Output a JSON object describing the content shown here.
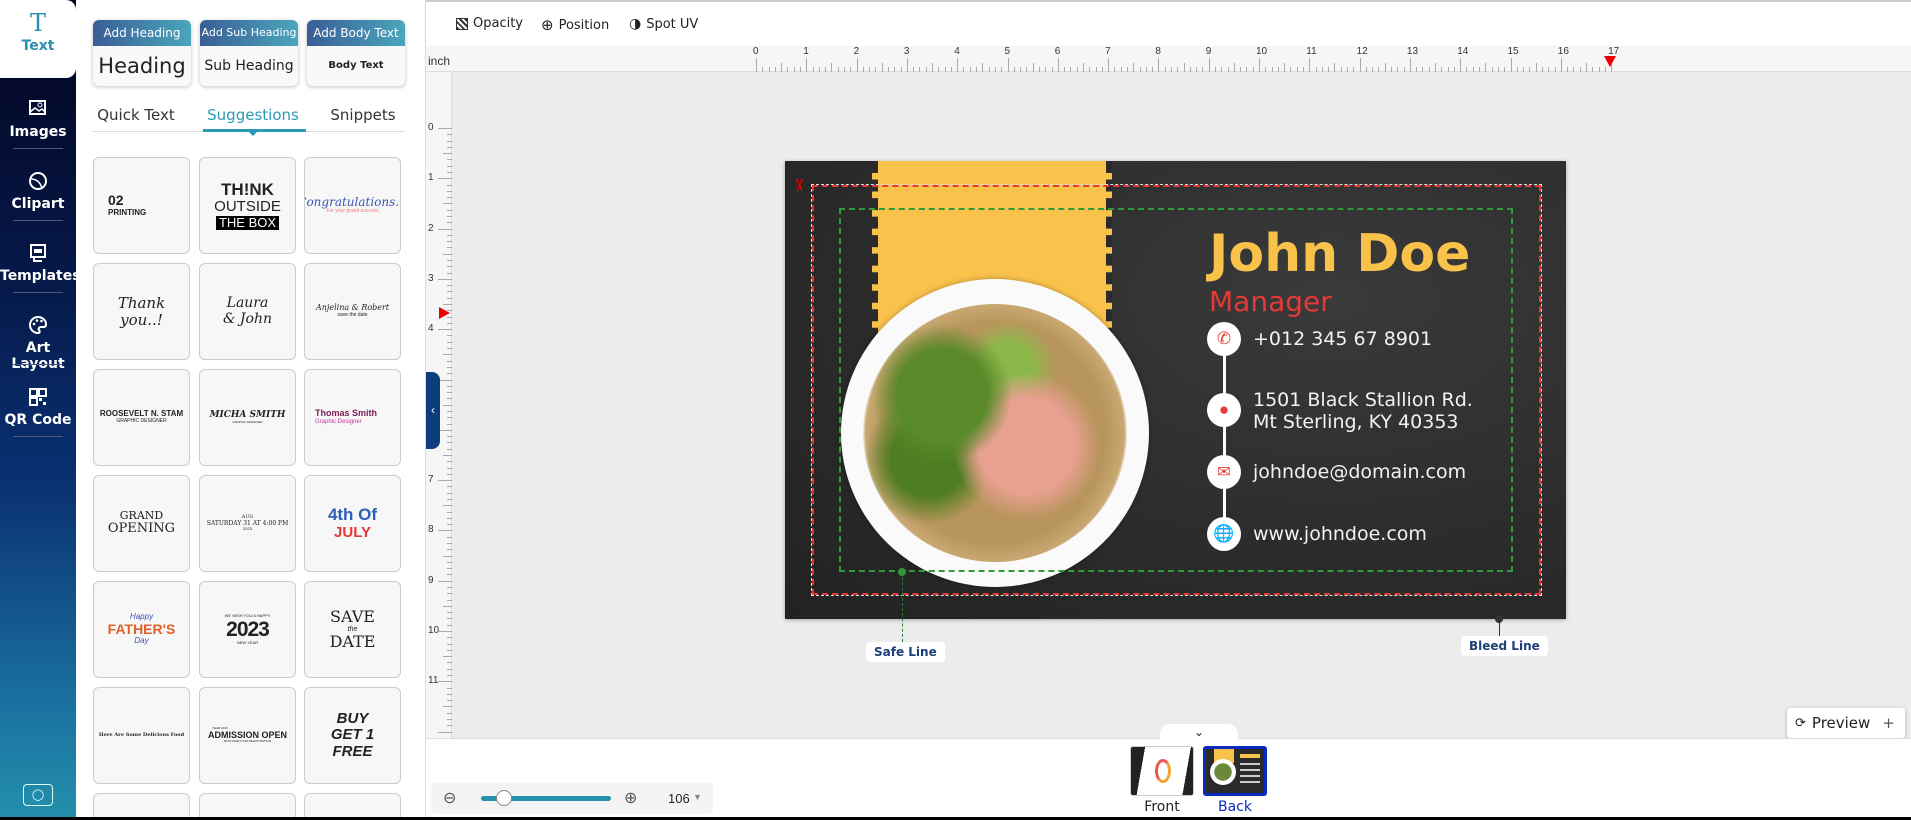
{
  "nav": {
    "items": [
      {
        "label": "Text",
        "icon": "text-icon",
        "active": true
      },
      {
        "label": "Images",
        "icon": "image-icon"
      },
      {
        "label": "Clipart",
        "icon": "clipart-icon"
      },
      {
        "label": "Templates",
        "icon": "templates-icon"
      },
      {
        "label": "Art Layout",
        "icon": "palette-icon"
      },
      {
        "label": "QR Code",
        "icon": "qr-code-icon"
      }
    ],
    "help_icon": "lightbulb-icon"
  },
  "panel": {
    "add_buttons": [
      {
        "header": "Add Heading",
        "sample": "Heading"
      },
      {
        "header": "Add Sub Heading",
        "sample": "Sub Heading"
      },
      {
        "header": "Add Body Text",
        "sample": "Body Text"
      }
    ],
    "tabs": [
      {
        "label": "Quick Text"
      },
      {
        "label": "Suggestions",
        "active": true
      },
      {
        "label": "Snippets"
      }
    ],
    "suggestions": [
      {
        "l1": "02",
        "l2": "PRINTING"
      },
      {
        "l1": "TH!NK",
        "l2": "OUTSIDE",
        "l3": "THE BOX"
      },
      {
        "l1": "Congratulations..!",
        "l2": "For your grand success"
      },
      {
        "l1": "Thank",
        "l2": "you..!"
      },
      {
        "l1": "Laura",
        "l2": "& John"
      },
      {
        "l1": "Anjelina & Robert",
        "l2": "save the date"
      },
      {
        "l1": "ROOSEVELT N. STAM",
        "l2": "GRAPHIC DESIGNER"
      },
      {
        "l1": "MICHA SMITH",
        "l2": "GRAPHIC DESIGNER"
      },
      {
        "l1": "Thomas Smith",
        "l2": "Graphic Designer"
      },
      {
        "l1": "GRAND",
        "l2": "OPENING"
      },
      {
        "l1": "AUG",
        "l2": "SATURDAY 31 AT 4:00 PM",
        "l3": "2023"
      },
      {
        "l1": "4th Of",
        "l2": "JULY"
      },
      {
        "l1": "Happy",
        "l2": "FATHER'S",
        "l3": "Day"
      },
      {
        "l1": "WE WISH YOU A HAPPY",
        "l2": "2023",
        "l3": "NEW YEAR"
      },
      {
        "l1": "SAVE",
        "l2": "the",
        "l3": "DATE"
      },
      {
        "l1": "Here Are Some Delicious Food",
        "l2": ""
      },
      {
        "l1": "YEAR 2023",
        "l2": "ADMISSION OPEN",
        "l3": "NOW OPEN FOR REGISTRATION"
      },
      {
        "l1": "BUY",
        "l2": "GET 1",
        "l3": "FREE"
      }
    ]
  },
  "toolbar": {
    "items": [
      {
        "label": "Opacity",
        "icon": "opacity-icon"
      },
      {
        "label": "Position",
        "icon": "position-icon"
      },
      {
        "label": "Spot UV",
        "icon": "spot-uv-icon"
      }
    ]
  },
  "ruler": {
    "unit": "inch",
    "h_labels": [
      "0",
      "1",
      "2",
      "3",
      "4",
      "5",
      "6",
      "7",
      "8",
      "9",
      "10",
      "11",
      "12",
      "13",
      "14",
      "15",
      "16",
      "17"
    ],
    "v_labels": [
      "0",
      "1",
      "2",
      "3",
      "4",
      "5",
      "6",
      "7",
      "8",
      "9",
      "10",
      "11"
    ]
  },
  "card": {
    "name": "John Doe",
    "title": "Manager",
    "phone": "+012 345 67 8901",
    "address_line1": "1501 Black Stallion Rd.",
    "address_line2": "Mt Sterling, KY 40353",
    "email": "johndoe@domain.com",
    "website": "www.johndoe.com",
    "colors": {
      "background": "#2b2b2b",
      "accent_yellow": "#f9c24b",
      "accent_red": "#e53935"
    }
  },
  "guides": {
    "safe_label": "Safe Line",
    "bleed_label": "Bleed Line"
  },
  "preview_button": "Preview",
  "pages": [
    {
      "label": "Front"
    },
    {
      "label": "Back",
      "active": true
    }
  ],
  "zoom": {
    "value": "106",
    "slider_fraction": 0.18
  }
}
